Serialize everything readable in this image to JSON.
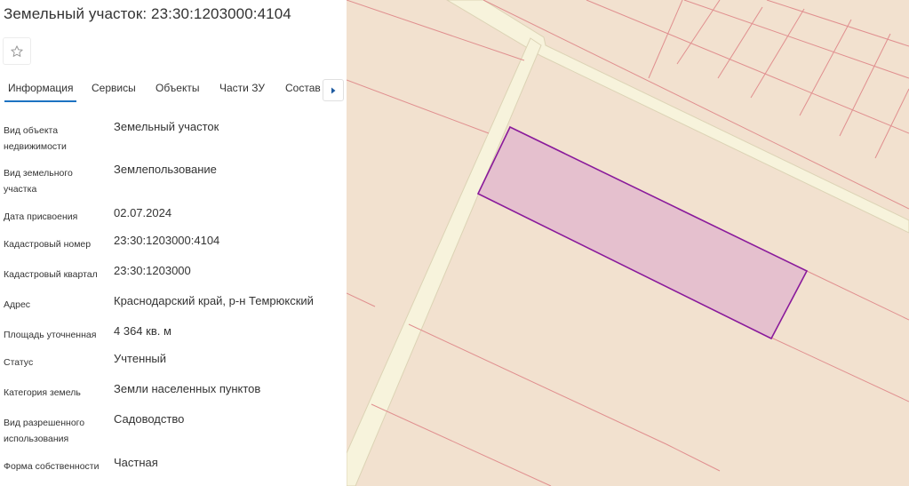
{
  "header": {
    "title": "Земельный участок: 23:30:1203000:4104"
  },
  "tabs": [
    {
      "label": "Информация",
      "active": true
    },
    {
      "label": "Сервисы",
      "active": false
    },
    {
      "label": "Объекты",
      "active": false
    },
    {
      "label": "Части ЗУ",
      "active": false
    },
    {
      "label": "Состав",
      "active": false
    }
  ],
  "fields": [
    {
      "label": "Вид объекта недвижимости",
      "value": "Земельный участок"
    },
    {
      "label": "Вид земельного участка",
      "value": "Землепользование"
    },
    {
      "label": "Дата присвоения",
      "value": "02.07.2024"
    },
    {
      "label": "Кадастровый номер",
      "value": "23:30:1203000:4104"
    },
    {
      "label": "Кадастровый квартал",
      "value": "23:30:1203000"
    },
    {
      "label": "Адрес",
      "value": "Краснодарский край, р-н Темрюкский"
    },
    {
      "label": "Площадь уточненная",
      "value": "4 364 кв. м"
    },
    {
      "label": "Статус",
      "value": "Учтенный"
    },
    {
      "label": "Категория земель",
      "value": "Земли населенных пунктов"
    },
    {
      "label": "Вид разрешенного использования",
      "value": "Садоводство"
    },
    {
      "label": "Форма собственности",
      "value": "Частная"
    }
  ],
  "icons": {
    "favorite": "star-outline-icon",
    "next": "chevron-right-icon"
  },
  "colors": {
    "accent": "#1d73c2",
    "map_background": "#f2e1cf",
    "road": "#f7f3dc",
    "parcel_boundary": "#e08f8f",
    "selected_fill": "#e3bccd",
    "selected_stroke": "#8a1a9b"
  }
}
